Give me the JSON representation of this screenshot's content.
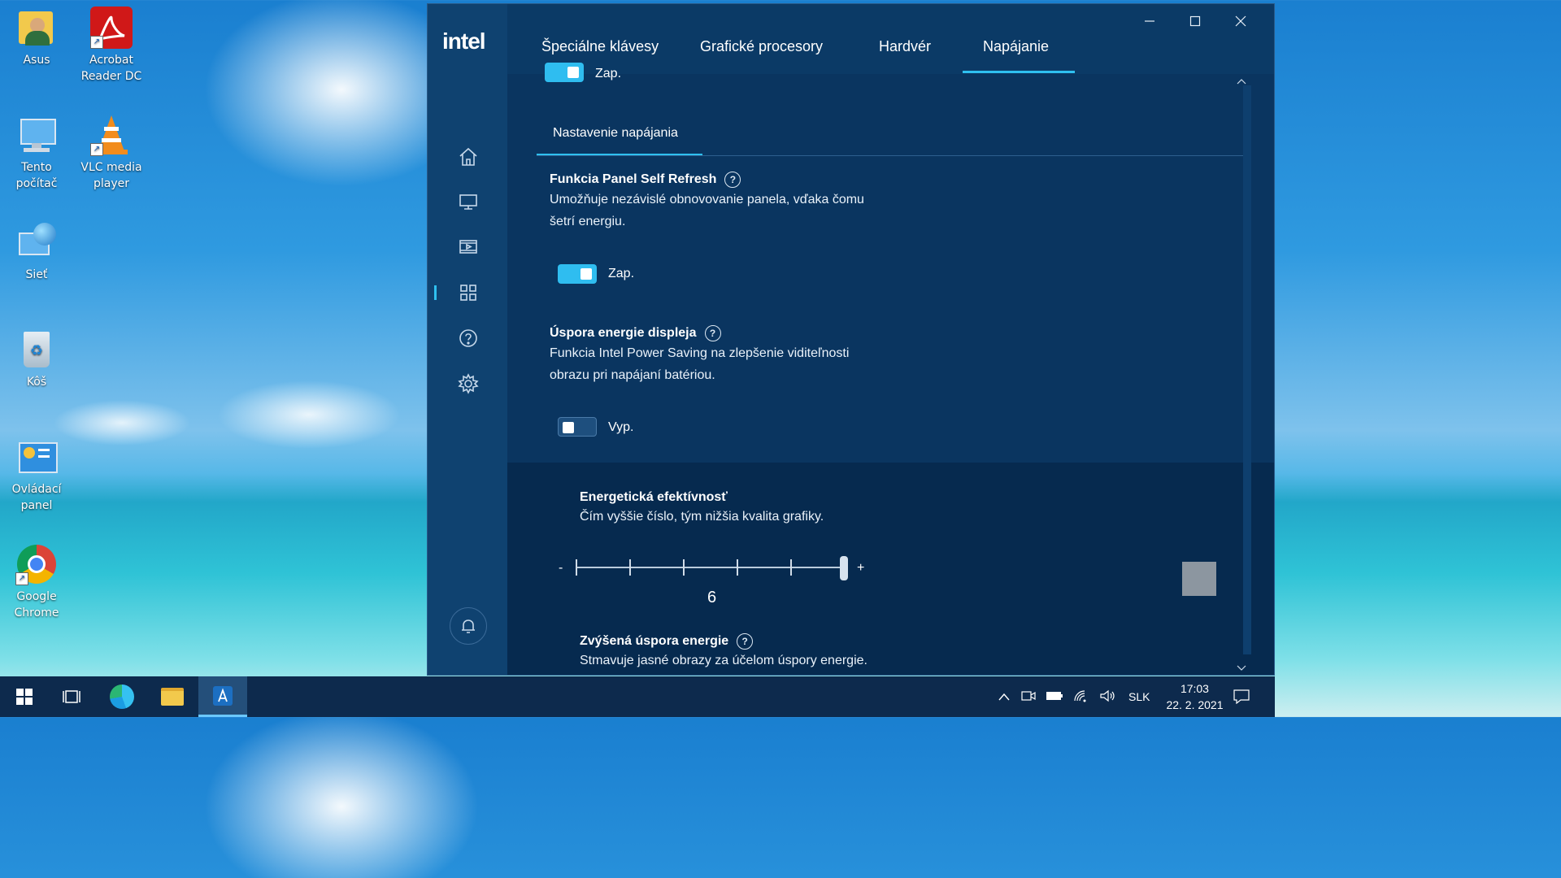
{
  "desktop": {
    "icons": [
      {
        "label": "Asus"
      },
      {
        "label": "Acrobat Reader DC"
      },
      {
        "label": "Tento počítač"
      },
      {
        "label": "VLC media player"
      },
      {
        "label": "Sieť"
      },
      {
        "label": "Kôš"
      },
      {
        "label": "Ovládací panel"
      },
      {
        "label": "Google Chrome"
      }
    ]
  },
  "app": {
    "logo": "intel",
    "tabs": [
      {
        "label": "Špeciálne klávesy"
      },
      {
        "label": "Grafické procesory"
      },
      {
        "label": "Hardvér"
      },
      {
        "label": "Napájanie"
      }
    ],
    "active_tab": "Napájanie",
    "top_partial_toggle_label": "Zap.",
    "subtab": "Nastavenie napájania",
    "psr": {
      "title": "Funkcia Panel Self Refresh",
      "desc1": "Umožňuje nezávislé obnovovanie panela, vďaka čomu",
      "desc2": "šetrí energiu.",
      "state": "Zap."
    },
    "display_saving": {
      "title": "Úspora energie displeja",
      "desc1": "Funkcia Intel Power Saving na zlepšenie viditeľnosti",
      "desc2": "obrazu pri napájaní batériou.",
      "state": "Vyp."
    },
    "efficiency": {
      "title": "Energetická efektívnosť",
      "desc": "Čím vyššie číslo, tým nižšia kvalita grafiky.",
      "minus": "-",
      "plus": "+",
      "value": "6"
    },
    "enhanced": {
      "title": "Zvýšená úspora energie",
      "desc": "Stmavuje jasné obrazy za účelom úspory energie."
    },
    "help_symbol": "?"
  },
  "taskbar": {
    "language": "SLK",
    "time": "17:03",
    "date": "22. 2. 2021"
  },
  "colors": {
    "accent": "#2fbdf0",
    "panel_bg": "#0a3560",
    "sidebar_bg": "#0f4270"
  }
}
